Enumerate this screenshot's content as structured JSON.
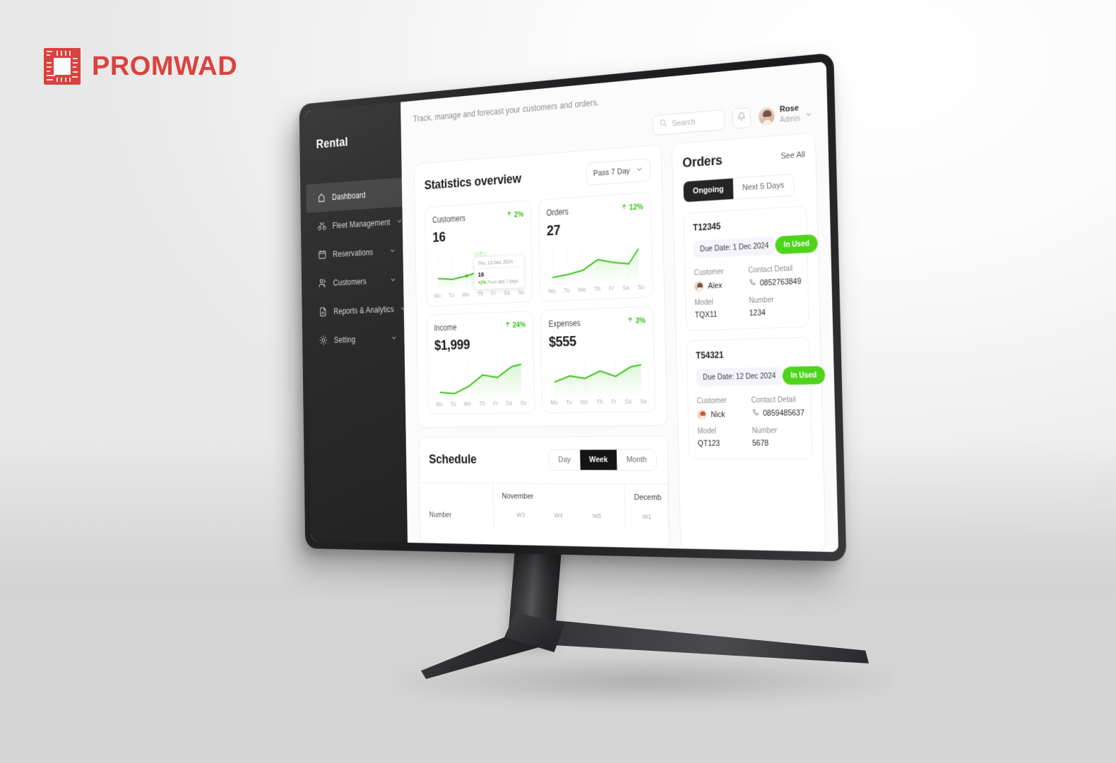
{
  "brand": {
    "logo_text": "PROMWAD",
    "logo_icon": "circuit-chip-icon",
    "logo_color": "#d9433f"
  },
  "app": {
    "name": "Rental",
    "tagline": "Track, manage and forecast your customers and orders."
  },
  "sidebar": {
    "items": [
      {
        "label": "Dashboard",
        "icon": "home-icon",
        "active": true,
        "expandable": false
      },
      {
        "label": "Fleet Management",
        "icon": "bicycle-icon",
        "active": false,
        "expandable": true
      },
      {
        "label": "Reservations",
        "icon": "calendar-icon",
        "active": false,
        "expandable": true
      },
      {
        "label": "Customers",
        "icon": "people-icon",
        "active": false,
        "expandable": true
      },
      {
        "label": "Reports & Analytics",
        "icon": "document-chart-icon",
        "active": false,
        "expandable": true
      },
      {
        "label": "Setting",
        "icon": "gear-icon",
        "active": false,
        "expandable": true
      }
    ]
  },
  "toolbar": {
    "search_placeholder": "Search",
    "search_icon": "search-icon",
    "bell_icon": "bell-icon",
    "user_name": "Rose",
    "user_role": "Admin",
    "caret_icon": "chevron-down-icon"
  },
  "statistics": {
    "title": "Statistics overview",
    "range_label": "Pass 7 Day",
    "tooltip": {
      "date": "Thu, 13 Dec 2024",
      "value": "16",
      "delta": "+2%",
      "note": "From last 7 days"
    },
    "cards": [
      {
        "label": "Customers",
        "value": "16",
        "delta": "2%",
        "trend": "up"
      },
      {
        "label": "Orders",
        "value": "27",
        "delta": "12%",
        "trend": "up"
      },
      {
        "label": "Income",
        "value": "$1,999",
        "delta": "24%",
        "trend": "up"
      },
      {
        "label": "Expenses",
        "value": "$555",
        "delta": "3%",
        "trend": "up"
      }
    ]
  },
  "chart_data": [
    {
      "type": "line",
      "title": "Customers",
      "categories": [
        "Mo",
        "Tu",
        "We",
        "Th",
        "Fr",
        "Sa",
        "Su"
      ],
      "values": [
        30,
        26,
        33,
        44,
        56,
        68,
        78
      ],
      "ylabel": "",
      "xlabel": "",
      "grid": true,
      "legend": "none",
      "annotation": "Thu, 13 Dec 2024 — 16 (+2% From last 7 days)"
    },
    {
      "type": "line",
      "title": "Orders",
      "categories": [
        "Mo",
        "Tu",
        "We",
        "Th",
        "Fr",
        "Sa",
        "Su"
      ],
      "values": [
        18,
        22,
        30,
        55,
        47,
        42,
        80
      ],
      "ylabel": "",
      "xlabel": "",
      "grid": true,
      "legend": "none"
    },
    {
      "type": "line",
      "title": "Income",
      "categories": [
        "Mo",
        "Tu",
        "We",
        "Th",
        "Fr",
        "Sa",
        "Su"
      ],
      "values": [
        14,
        10,
        24,
        52,
        44,
        72,
        80
      ],
      "ylabel": "",
      "xlabel": "",
      "grid": true,
      "legend": "none"
    },
    {
      "type": "line",
      "title": "Expenses",
      "categories": [
        "Mo",
        "Tu",
        "We",
        "Th",
        "Fr",
        "Sa",
        "Su"
      ],
      "values": [
        34,
        48,
        42,
        58,
        44,
        66,
        70
      ],
      "ylabel": "",
      "xlabel": "",
      "grid": true,
      "legend": "none"
    }
  ],
  "schedule": {
    "title": "Schedule",
    "views": [
      {
        "label": "Day",
        "active": false
      },
      {
        "label": "Week",
        "active": true
      },
      {
        "label": "Month",
        "active": false
      }
    ],
    "column_header": "Number",
    "months": [
      {
        "name": "November",
        "weeks": [
          "W3",
          "W4",
          "W5"
        ]
      },
      {
        "name": "Decemb",
        "weeks": [
          "W1"
        ]
      }
    ]
  },
  "orders": {
    "title": "Orders",
    "see_all_label": "See All",
    "tabs": [
      {
        "label": "Ongoing",
        "active": true
      },
      {
        "label": "Next 5 Days",
        "active": false
      }
    ],
    "field_labels": {
      "customer": "Customer",
      "contact": "Contact Detail",
      "model": "Model",
      "number": "Number"
    },
    "items": [
      {
        "id": "T12345",
        "due": "Due Date: 1 Dec 2024",
        "status": "In Used",
        "customer": "Alex",
        "contact": "0852763849",
        "model": "TQX11",
        "number": "1234"
      },
      {
        "id": "T54321",
        "due": "Due Date: 12 Dec 2024",
        "status": "In Used",
        "customer": "Nick",
        "contact": "0859485637",
        "model": "QT123",
        "number": "5678"
      }
    ]
  },
  "colors": {
    "accent_green": "#4fd41c",
    "line_green": "#3ac21a",
    "brand_red": "#d9433f",
    "sidebar_dark": "#2a2a2a",
    "pill_dark": "#252525"
  }
}
